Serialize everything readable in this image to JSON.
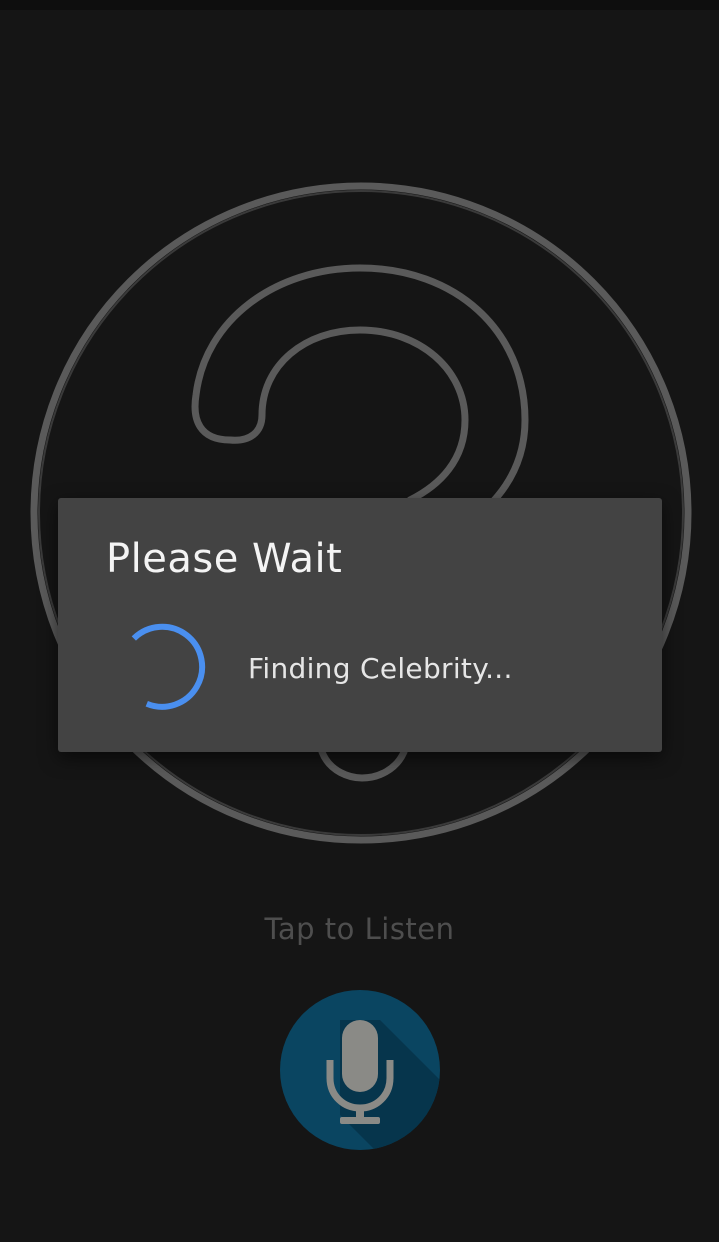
{
  "app": {
    "tap_label": "Tap to Listen"
  },
  "dialog": {
    "title": "Please Wait",
    "message": "Finding Celebrity..."
  },
  "colors": {
    "background": "#151515",
    "graphic_stroke": "#5a5a5a",
    "dialog_bg": "#434343",
    "spinner": "#4a8fef",
    "mic_button": "#0a4561"
  },
  "icons": {
    "graphic": "question-mark-circle-icon",
    "spinner": "loading-spinner-icon",
    "mic": "microphone-icon"
  }
}
